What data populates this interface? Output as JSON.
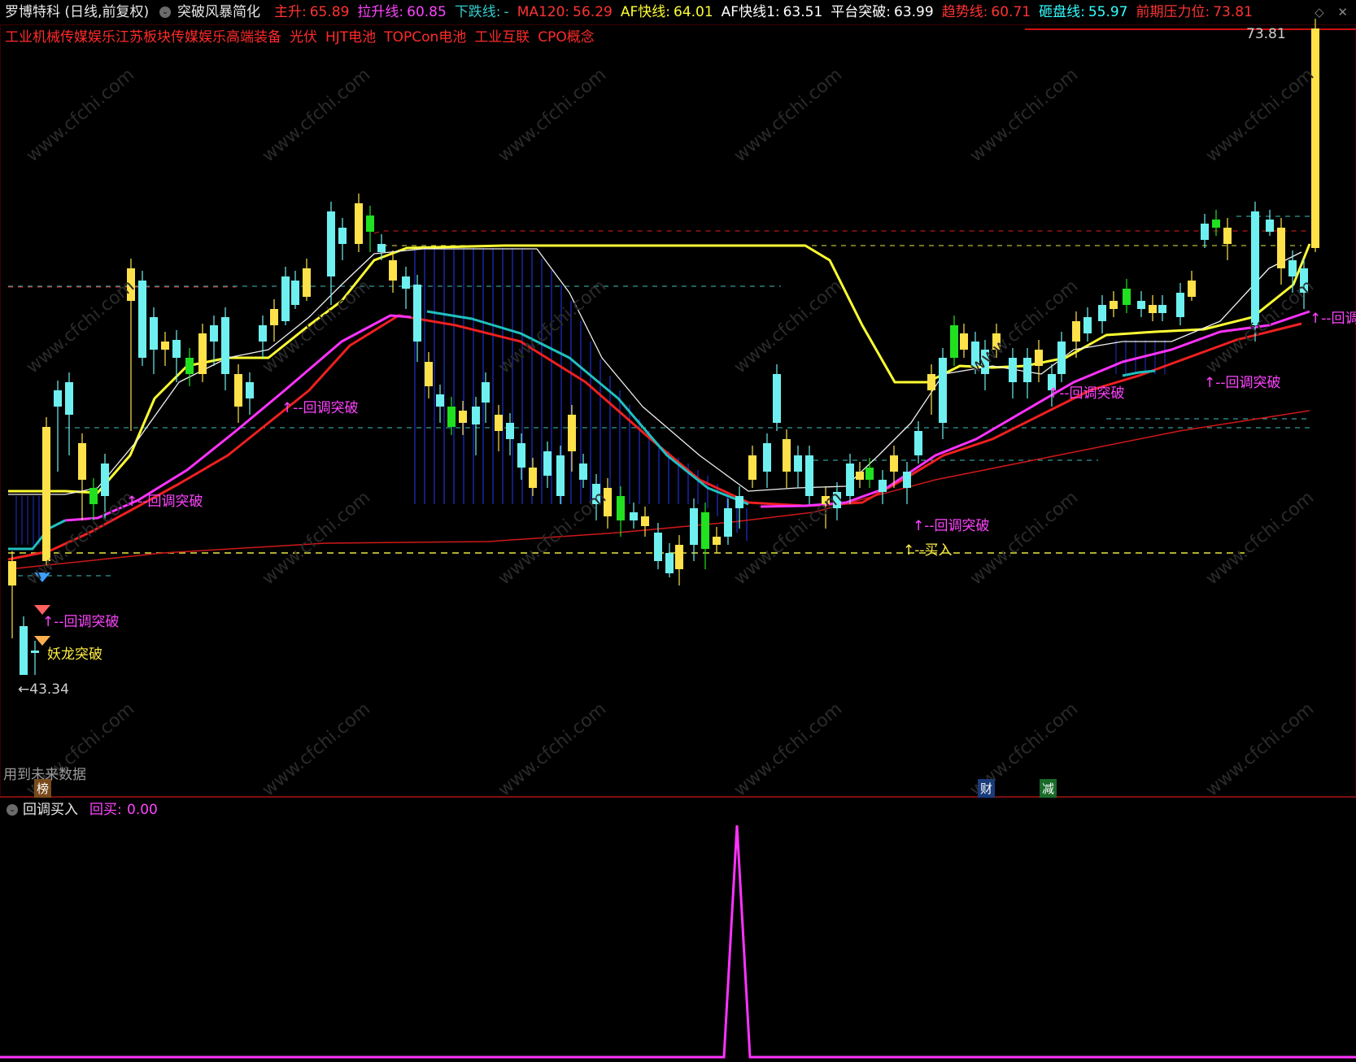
{
  "header": {
    "symbol": "罗博特科 (日线,前复权)",
    "indicator_name": "突破风暴简化",
    "values": [
      {
        "label": "主升:",
        "value": "65.89",
        "color": "#ff3333"
      },
      {
        "label": "拉升线:",
        "value": "60.85",
        "color": "#ff44ff"
      },
      {
        "label": "下跌线:",
        "value": "-",
        "color": "#33cccc"
      },
      {
        "label": "MA120:",
        "value": "56.29",
        "color": "#ff3333"
      },
      {
        "label": "AF快线:",
        "value": "64.01",
        "color": "#ffff33"
      },
      {
        "label": "AF快线1:",
        "value": "63.51",
        "color": "#ffffff"
      },
      {
        "label": "平台突破:",
        "value": "63.99",
        "color": "#ffffff"
      },
      {
        "label": "趋势线:",
        "value": "60.71",
        "color": "#ff3333"
      },
      {
        "label": "砸盘线:",
        "value": "55.97",
        "color": "#33ffff"
      },
      {
        "label": "前期压力位:",
        "value": "73.81",
        "color": "#ff3333"
      }
    ],
    "right_icons": [
      "diamond-icon",
      "close-icon"
    ]
  },
  "concepts": [
    "工业机械传媒娱乐江苏板块传媒娱乐高端装备",
    "光伏",
    "HJT电池",
    "TOPCon电池",
    "工业互联",
    "CPO概念"
  ],
  "price_labels": {
    "high": "73.81",
    "low": "43.34"
  },
  "signals": {
    "pullback": "↑--回调突破",
    "pullback_right": "↑--回调",
    "buy": "↑--买入",
    "dragon": "妖龙突破",
    "future": "用到未来数据"
  },
  "markers": {
    "bang": "榜",
    "cai": "财",
    "jian": "减"
  },
  "sub_panel": {
    "name": "回调买入",
    "value_label": "回买:",
    "value": "0.00"
  },
  "watermark": "www.cfchi.com",
  "colors": {
    "up": "#6ef0f0",
    "down": "#ffe24a",
    "red": "#ff2020",
    "magenta": "#ff33ff",
    "yellow": "#ffff44",
    "teal": "#20c0c0",
    "blue": "#1f2fd0",
    "green": "#20e020"
  }
}
